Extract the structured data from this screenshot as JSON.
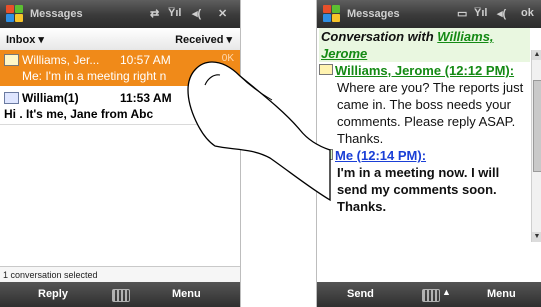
{
  "left": {
    "title": "Messages",
    "title_icons": [
      "sync-icon",
      "signal-icon",
      "volume-icon",
      "close-icon"
    ],
    "tabs": {
      "left": "Inbox",
      "right": "Received"
    },
    "rows": [
      {
        "sender": "Williams, Jer...",
        "time": "10:57 AM",
        "indicator": "0K",
        "preview": "Me: I'm in a meeting right n"
      },
      {
        "sender": "William(1)",
        "time": "11:53 AM",
        "preview": "Hi . It's me, Jane from Abc"
      }
    ],
    "status": "1 conversation selected",
    "softkeys": {
      "left": "Reply",
      "right": "Menu"
    }
  },
  "right": {
    "title": "Messages",
    "ok": "ok",
    "header_prefix": "Conversation with ",
    "header_name": "Williams, Jerome",
    "sender_line": "Williams, Jerome (12:12 PM):",
    "message1": "Where are you? The reports just came in. The boss needs your comments. Please reply ASAP. Thanks.",
    "me_line": "Me (12:14 PM):",
    "message2": "I'm in a meeting now. I will send my comments soon. Thanks.",
    "softkeys": {
      "left": "Send",
      "right": "Menu"
    }
  }
}
